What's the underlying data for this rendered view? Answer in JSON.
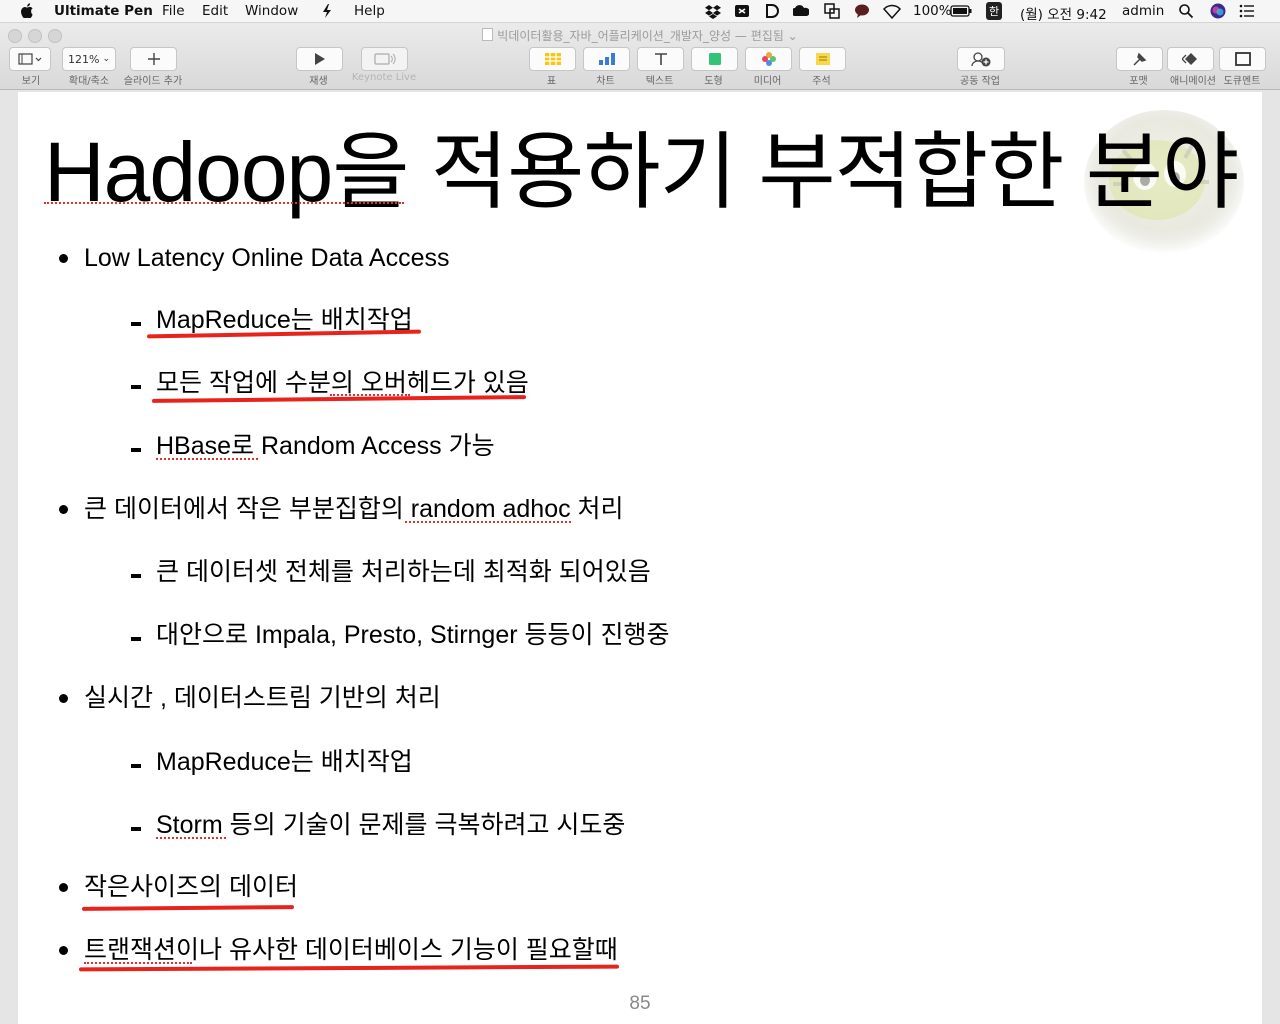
{
  "menubar": {
    "app_name": "Ultimate Pen",
    "menus": [
      "File",
      "Edit",
      "Window",
      "Help"
    ],
    "battery": "100%",
    "input_method": "한",
    "clock": "(월) 오전 9:42",
    "user": "admin"
  },
  "window": {
    "title": "빅데이터활용_자바_어플리케이션_개발자_양성",
    "status": "— 편집됨"
  },
  "toolbar": {
    "view_label": "보기",
    "zoom_value": "121%",
    "zoom_label": "확대/축소",
    "add_slide_label": "슬라이드 추가",
    "play_label": "재생",
    "keynote_live_label": "Keynote Live",
    "table_label": "표",
    "chart_label": "차트",
    "text_label": "텍스트",
    "shape_label": "도형",
    "media_label": "미디어",
    "comment_label": "주석",
    "collaborate_label": "공동 작업",
    "format_label": "포맷",
    "animate_label": "애니메이션",
    "document_label": "도큐멘트"
  },
  "slide": {
    "title": "Hadoop을 적용하기 부적합한 분야",
    "bullets": [
      "Low Latency Online Data Access",
      "MapReduce는 배치작업",
      "모든 작업에 수분의 오버헤드가 있음",
      "HBase로 Random Access 가능",
      "큰 데이터에서 작은 부분집합의 random adhoc 처리",
      "큰 데이터셋 전체를 처리하는데 최적화 되어있음",
      "대안으로 Impala, Presto, Stirnger 등등이 진행중",
      "실시간 ,  데이터스트림 기반의 처리",
      "MapReduce는 배치작업",
      "Storm 등의 기술이 문제를 극복하려고 시도중",
      "작은사이즈의 데이터",
      "트랜잭션이나 유사한 데이터베이스 기능이 필요할때"
    ],
    "page_number": "85"
  },
  "colors": {
    "annotation_red": "#e8231c",
    "spellcheck_red": "#e03030",
    "table_yellow": "#f5c518",
    "chart_blue": "#3a7bd5",
    "shape_green": "#34c27a",
    "comment_yellow": "#f7d84a"
  },
  "icons": [
    "apple-icon",
    "dropbox-icon",
    "search-icon",
    "siri-icon",
    "notification-center-icon",
    "view-icon",
    "add-icon",
    "play-icon",
    "keynote-live-icon",
    "table-icon",
    "chart-icon",
    "text-icon",
    "shape-icon",
    "media-icon",
    "comment-icon",
    "collaborate-icon",
    "format-icon",
    "animate-icon",
    "document-icon"
  ]
}
